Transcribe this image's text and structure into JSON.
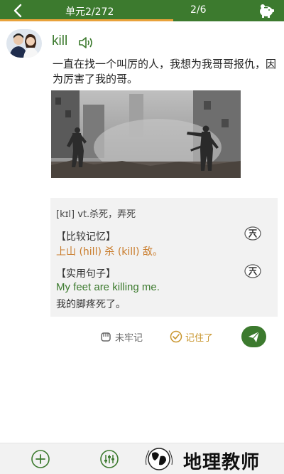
{
  "header": {
    "unit_progress": "单元2/272",
    "page_progress": "2/6",
    "progress_fraction": 0.61
  },
  "word": {
    "text": "kill",
    "sentence": "一直在找一个叫厉的人，我想为我哥哥报仇，因为厉害了我的哥。"
  },
  "card": {
    "phonetic": "[kɪl] vt.杀死，弄死",
    "mnemonic_title": "【比较记忆】",
    "mnemonic": "上山 (hill) 杀 (kill) 敌。",
    "example_title": "【实用句子】",
    "example_en": "My feet are killing me.",
    "example_zh": "我的脚疼死了。"
  },
  "actions": {
    "not_remembered": "未牢记",
    "remembered": "记住了"
  },
  "bottom": {
    "watermark": "地理教师"
  },
  "colors": {
    "primary": "#3c7a2e",
    "progress": "#e9a23b",
    "mnemonic": "#c97b2a"
  }
}
